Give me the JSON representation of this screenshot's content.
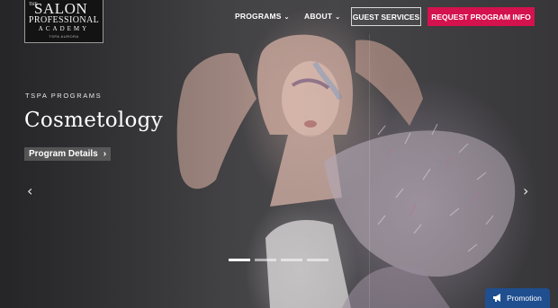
{
  "logo": {
    "the": "THE",
    "salon": "SALON",
    "professional": "PROFESSIONAL",
    "academy": "ACADEMY",
    "location": "TSPA AURORA",
    "icon": "salon-logo"
  },
  "nav": {
    "programs": "PROGRAMS",
    "about": "ABOUT",
    "chevron": "⌄",
    "guest_services": "GUEST SERVICES",
    "request_info": "REQUEST PROGRAM INFO"
  },
  "hero": {
    "eyebrow": "TSPA PROGRAMS",
    "title": "Cosmetology",
    "details_label": "Program Details",
    "details_arrow": "›",
    "prev_arrow": "‹",
    "next_arrow": "›",
    "slides": 4,
    "active_slide": 1
  },
  "promo": {
    "label": "Promotion",
    "icon": "megaphone-icon"
  },
  "colors": {
    "accent": "#d4124e",
    "promo": "#1f4f8f"
  }
}
